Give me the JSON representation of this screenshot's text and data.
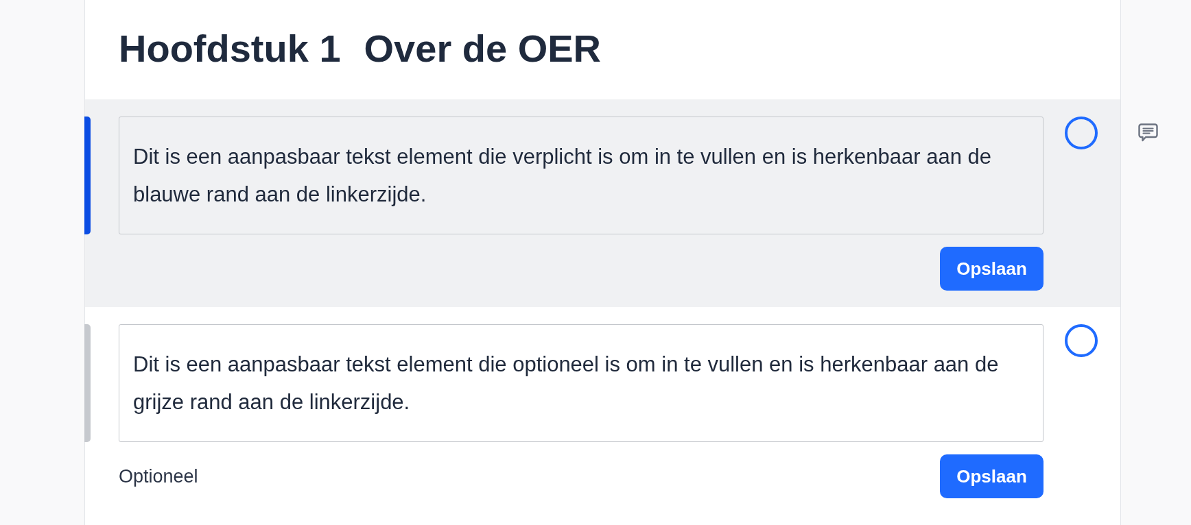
{
  "heading": {
    "chapter": "Hoofdstuk 1",
    "title": "Over de OER"
  },
  "elements": [
    {
      "kind": "required",
      "selected": true,
      "done": false,
      "text": "Dit is een aanpasbaar tekst element die verplicht is om in te vullen en is herkenbaar aan de blauwe rand aan de linkerzijde.",
      "button": "Opslaan"
    },
    {
      "kind": "optional",
      "selected": false,
      "done": false,
      "text": "Dit is een aanpasbaar tekst element die optioneel is om in te vullen en is herkenbaar aan de grijze rand aan de linkerzijde.",
      "note": "Optioneel",
      "button": "Opslaan"
    }
  ]
}
